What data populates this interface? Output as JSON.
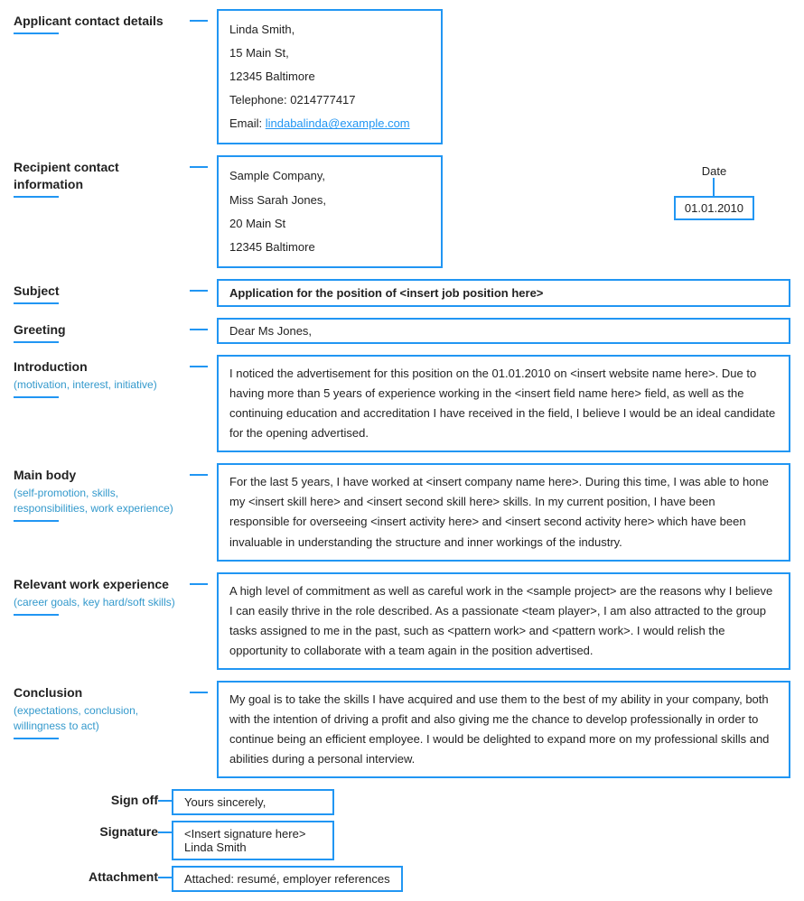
{
  "sections": {
    "applicant": {
      "label": "Applicant contact details",
      "lines": [
        "Linda Smith,",
        "15 Main St,",
        "12345 Baltimore",
        "Telephone: 0214777417",
        "Email: "
      ],
      "email_text": "lindabalinda@example.com"
    },
    "recipient": {
      "label": "Recipient contact information",
      "lines": [
        "Sample Company,",
        "Miss Sarah Jones,",
        "20 Main St",
        "12345 Baltimore"
      ]
    },
    "date": {
      "label": "Date",
      "value": "01.01.2010"
    },
    "subject": {
      "label": "Subject",
      "content": "Application for the position of <insert job position here>"
    },
    "greeting": {
      "label": "Greeting",
      "content": "Dear Ms Jones,"
    },
    "introduction": {
      "label": "Introduction",
      "sub": "(motivation, interest, initiative)",
      "content": "I noticed the advertisement for this position on the 01.01.2010 on <insert website name here>. Due to having more than 5 years of experience working in the <insert field name here> field, as well as the continuing education and accreditation I have received in the field, I believe I would be an ideal candidate for the opening advertised."
    },
    "main_body": {
      "label": "Main body",
      "sub": "(self-promotion, skills, responsibilities, work experience)",
      "content": "For the last 5 years, I have worked at <insert company name here>. During this time, I was able to hone my <insert skill here> and <insert second skill here> skills. In my current position, I have been responsible for overseeing <insert activity here> and <insert second activity here> which have been invaluable in understanding the structure and inner workings of the industry."
    },
    "relevant_work": {
      "label": "Relevant work experience",
      "sub": "(career goals, key hard/soft skills)",
      "content": "A high level of commitment as well as careful work in the <sample project> are the reasons why I believe I can easily thrive in the role described. As a passionate <team player>, I am also attracted to the group tasks assigned to me in the past, such as <pattern work> and <pattern work>. I would relish the opportunity to collaborate with a team again in the position advertised."
    },
    "conclusion": {
      "label": "Conclusion",
      "sub": "(expectations, conclusion, willingness to act)",
      "content": "My goal is to take the skills I have acquired and use them to the best of my ability in your company, both with the intention of driving a profit and also giving me the chance to develop professionally in order to continue being an efficient employee. I would be delighted to expand more on my professional skills and abilities during a personal interview."
    },
    "signoff": {
      "label": "Sign off",
      "content": "Yours sincerely,"
    },
    "signature": {
      "label": "Signature",
      "content": "<Insert signature here>"
    },
    "signature_name": {
      "content": "Linda Smith"
    },
    "attachment": {
      "label": "Attachment",
      "content": "Attached: resumé, employer references"
    }
  }
}
